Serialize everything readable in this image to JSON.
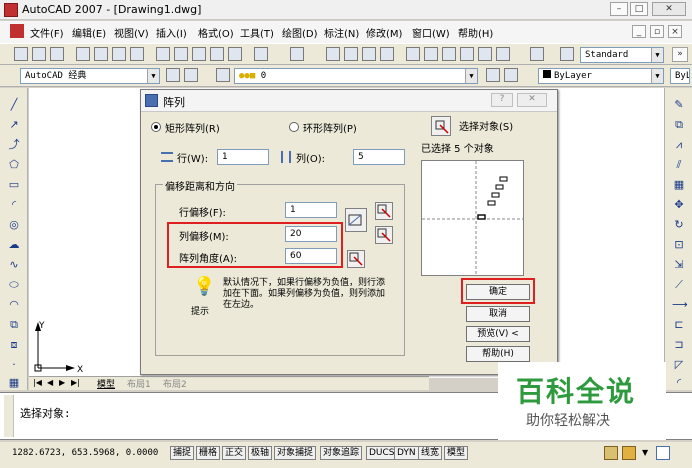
{
  "window": {
    "title": "AutoCAD 2007 - [Drawing1.dwg]"
  },
  "menubar": {
    "items": [
      "文件(F)",
      "编辑(E)",
      "视图(V)",
      "插入(I)",
      "格式(O)",
      "工具(T)",
      "绘图(D)",
      "标注(N)",
      "修改(M)",
      "窗口(W)",
      "帮助(H)"
    ]
  },
  "toolbar": {
    "text_style": "Standard",
    "workspace": "AutoCAD 经典",
    "layer": "0",
    "color": "ByLayer",
    "linetype": "ByLayer"
  },
  "tabs": [
    "模型",
    "布局1",
    "布局2"
  ],
  "command": {
    "prompt": "选择对象:"
  },
  "status": {
    "coords": "1282.6723, 653.5968, 0.0000",
    "buttons": [
      "捕捉",
      "栅格",
      "正交",
      "极轴",
      "对象捕捉",
      "对象追踪",
      "DUCS",
      "DYN",
      "线宽",
      "模型"
    ]
  },
  "dialog": {
    "title": "阵列",
    "radio_rect": "矩形阵列(R)",
    "radio_polar": "环形阵列(P)",
    "select_objects": "选择对象(S)",
    "selected_count": "已选择 5 个对象",
    "rows_label": "行(W):",
    "rows_value": "1",
    "cols_label": "列(O):",
    "cols_value": "5",
    "group_title": "偏移距离和方向",
    "row_offset_label": "行偏移(F):",
    "row_offset_value": "1",
    "col_offset_label": "列偏移(M):",
    "col_offset_value": "20",
    "angle_label": "阵列角度(A):",
    "angle_value": "60",
    "hint_title": "提示",
    "hint_text": "默认情况下，如果行偏移为负值，则行添加在下面。如果列偏移为负值，则列添加在左边。",
    "ok": "确定",
    "cancel": "取消",
    "preview": "预览(V) <",
    "help": "帮助(H)"
  },
  "watermark": {
    "title": "百科全说",
    "subtitle": "助你轻松解决"
  },
  "colors": {
    "highlight_red": "#e02020",
    "watermark_green": "#2e9a3e"
  }
}
